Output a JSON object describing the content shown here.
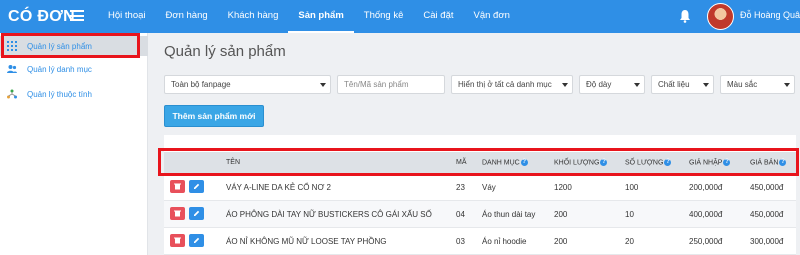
{
  "header": {
    "logo": "CÓ ĐƠN",
    "nav": [
      "Hội thoại",
      "Đơn hàng",
      "Khách hàng",
      "Sản phẩm",
      "Thống kê",
      "Cài đặt",
      "Vận đơn"
    ],
    "active_nav": "Sản phẩm",
    "username": "Đỗ Hoàng Quân"
  },
  "sidebar": {
    "items": [
      {
        "label": "Quản lý sản phẩm",
        "icon": "grid-icon"
      },
      {
        "label": "Quản lý danh mục",
        "icon": "users-icon"
      },
      {
        "label": "Quản lý thuộc tính",
        "icon": "tree-icon"
      }
    ]
  },
  "page": {
    "title": "Quản lý sản phẩm",
    "filters": {
      "fanpage": "Toàn bộ fanpage",
      "search_placeholder": "Tên/Mã sản phẩm",
      "category": "Hiển thị ở tất cả danh mục",
      "thickness": "Độ dày",
      "material": "Chất liệu",
      "color": "Màu sắc"
    },
    "add_button": "Thêm sản phẩm mới"
  },
  "table": {
    "columns": {
      "name": "TÊN",
      "code": "MÃ",
      "category": "DANH MỤC",
      "weight": "KHỐI LƯỢNG",
      "quantity": "SỐ LƯỢNG",
      "import_price": "GIÁ NHẬP",
      "sale_price": "GIÁ BÁN"
    },
    "rows": [
      {
        "name": "VÁY A-LINE DA KẺ CỔ NƠ 2",
        "code": "23",
        "category": "Váy",
        "weight": "1200",
        "quantity": "100",
        "import_price": "200,000đ",
        "sale_price": "450,000đ"
      },
      {
        "name": "ÁO PHÔNG DÀI TAY NỮ BUSTICKERS CÔ GÁI XẤU SỐ",
        "code": "04",
        "category": "Áo thun dài tay",
        "weight": "200",
        "quantity": "10",
        "import_price": "400,000đ",
        "sale_price": "450,000đ"
      },
      {
        "name": "ÁO NỈ KHÔNG MŨ NỮ LOOSE TAY PHỒNG",
        "code": "03",
        "category": "Áo nỉ hoodie",
        "weight": "200",
        "quantity": "20",
        "import_price": "250,000đ",
        "sale_price": "300,000đ"
      }
    ]
  },
  "colors": {
    "primary": "#2f8fe6",
    "highlight": "#e8141c",
    "delete": "#e8505b"
  }
}
